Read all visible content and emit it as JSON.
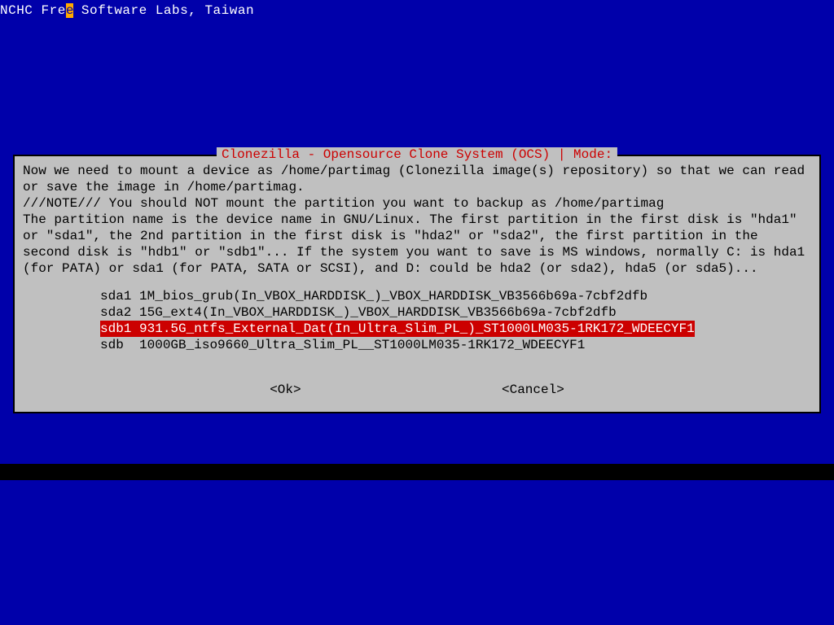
{
  "header": {
    "pre": "NCHC Fre",
    "cursor": "e",
    "post": " Software Labs, Taiwan"
  },
  "dialog": {
    "title": "Clonezilla - Opensource Clone System (OCS) | Mode:",
    "text": "Now we need to mount a device as /home/partimag (Clonezilla image(s) repository) so that we can read or save the image in /home/partimag.\n///NOTE/// You should NOT mount the partition you want to backup as /home/partimag\nThe partition name is the device name in GNU/Linux. The first partition in the first disk is \"hda1\" or \"sda1\", the 2nd partition in the first disk is \"hda2\" or \"sda2\", the first partition in the second disk is \"hdb1\" or \"sdb1\"... If the system you want to save is MS windows, normally C: is hda1 (for PATA) or sda1 (for PATA, SATA or SCSI), and D: could be hda2 (or sda2), hda5 (or sda5)...",
    "options": [
      {
        "dev": "sda1",
        "desc": "1M_bios_grub(In_VBOX_HARDDISK_)_VBOX_HARDDISK_VB3566b69a-7cbf2dfb",
        "selected": false
      },
      {
        "dev": "sda2",
        "desc": "15G_ext4(In_VBOX_HARDDISK_)_VBOX_HARDDISK_VB3566b69a-7cbf2dfb",
        "selected": false
      },
      {
        "dev": "sdb1",
        "desc": "931.5G_ntfs_External_Dat(In_Ultra_Slim_PL_)_ST1000LM035-1RK172_WDEECYF1",
        "selected": true
      },
      {
        "dev": "sdb",
        "desc": " 1000GB_iso9660_Ultra_Slim_PL__ST1000LM035-1RK172_WDEECYF1",
        "selected": false
      }
    ],
    "buttons": {
      "ok": "<Ok>",
      "cancel": "<Cancel>"
    }
  }
}
